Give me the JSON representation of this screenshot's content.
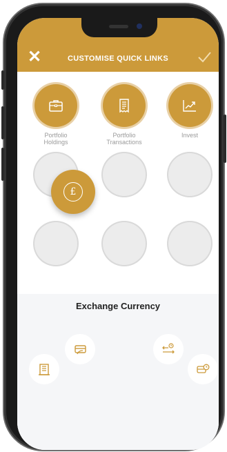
{
  "header": {
    "title": "CUSTOMISE QUICK LINKS",
    "accent_color": "#cc9a3a",
    "close_icon": "close-icon",
    "confirm_icon": "check-icon"
  },
  "quick_links": {
    "items": [
      {
        "label": "Portfolio\nHoldings",
        "icon": "briefcase-icon",
        "filled": true
      },
      {
        "label": "Portfolio\nTransactions",
        "icon": "receipt-icon",
        "filled": true
      },
      {
        "label": "Invest",
        "icon": "trend-chart-icon",
        "filled": true
      },
      {
        "label": "",
        "filled": false
      },
      {
        "label": "",
        "filled": false
      },
      {
        "label": "",
        "filled": false
      },
      {
        "label": "",
        "filled": false
      },
      {
        "label": "",
        "filled": false
      },
      {
        "label": "",
        "filled": false
      }
    ],
    "dragging_item": {
      "icon": "pound-icon",
      "symbol": "£"
    }
  },
  "available": {
    "heading": "Exchange Currency",
    "options": [
      {
        "icon": "card-icon"
      },
      {
        "icon": "exchange-arrows-icon"
      },
      {
        "icon": "bank-icon"
      },
      {
        "icon": "card-clock-icon"
      }
    ]
  }
}
